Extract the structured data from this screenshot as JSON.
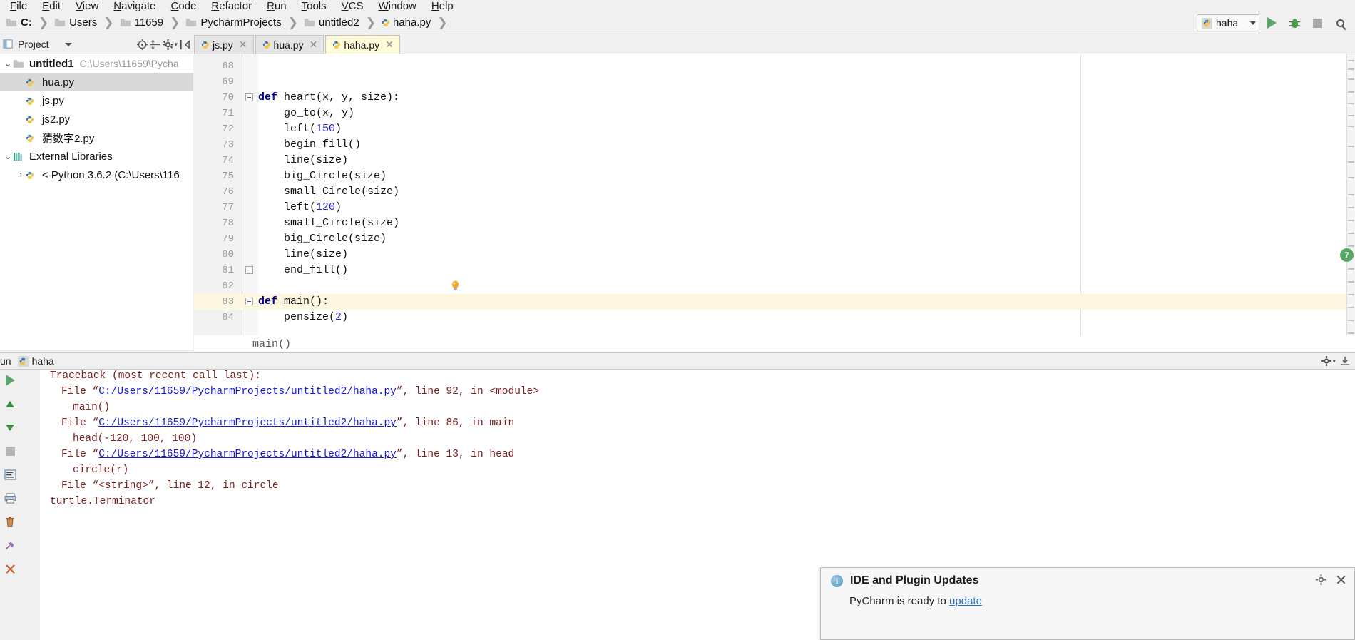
{
  "menu": {
    "items": [
      "File",
      "Edit",
      "View",
      "Navigate",
      "Code",
      "Refactor",
      "Run",
      "Tools",
      "VCS",
      "Window",
      "Help"
    ]
  },
  "navbar": {
    "crumbs": [
      {
        "label": "C:",
        "icon": "folder-icon",
        "bold": true
      },
      {
        "label": "Users",
        "icon": "folder-icon",
        "bold": false
      },
      {
        "label": "11659",
        "icon": "folder-icon",
        "bold": false
      },
      {
        "label": "PycharmProjects",
        "icon": "folder-icon",
        "bold": false
      },
      {
        "label": "untitled2",
        "icon": "folder-icon",
        "bold": false
      },
      {
        "label": "haha.py",
        "icon": "python-file-icon",
        "bold": false
      }
    ],
    "separator": "❯"
  },
  "toolbar": {
    "run_config": "haha",
    "run_button": "run-icon",
    "debug_button": "debug-icon",
    "stop_button": "stop-icon",
    "search_button": "search-icon"
  },
  "project_panel": {
    "title": "Project",
    "tree": [
      {
        "label": "untitled1",
        "path": "C:\\Users\\11659\\Pycha",
        "icon": "folder-icon",
        "bold": true,
        "arrow": "⌄",
        "indent": 0,
        "selected": false
      },
      {
        "label": "hua.py",
        "path": "",
        "icon": "python-file-icon",
        "bold": false,
        "arrow": "",
        "indent": 1,
        "selected": true
      },
      {
        "label": "js.py",
        "path": "",
        "icon": "python-file-icon",
        "bold": false,
        "arrow": "",
        "indent": 1,
        "selected": false
      },
      {
        "label": "js2.py",
        "path": "",
        "icon": "python-file-icon",
        "bold": false,
        "arrow": "",
        "indent": 1,
        "selected": false
      },
      {
        "label": "猜数字2.py",
        "path": "",
        "icon": "python-file-icon",
        "bold": false,
        "arrow": "",
        "indent": 1,
        "selected": false
      },
      {
        "label": "External Libraries",
        "path": "",
        "icon": "library-icon",
        "bold": false,
        "arrow": "⌄",
        "indent": 0,
        "selected": false
      },
      {
        "label": "< Python 3.6.2 (C:\\Users\\116",
        "path": "",
        "icon": "python-interpreter-icon",
        "bold": false,
        "arrow": "›",
        "indent": 1,
        "selected": false
      }
    ]
  },
  "editor": {
    "tabs": [
      {
        "label": "js.py",
        "active": false
      },
      {
        "label": "hua.py",
        "active": false
      },
      {
        "label": "haha.py",
        "active": true
      }
    ],
    "close_glyph": "✕",
    "breadcrumb": "main()",
    "first_line_number": 68,
    "lines": [
      {
        "n": 68,
        "text": "",
        "fold": false,
        "current": false
      },
      {
        "n": 69,
        "text": "",
        "fold": false,
        "current": false
      },
      {
        "n": 70,
        "text": "def heart(x, y, size):",
        "fold": true,
        "current": false
      },
      {
        "n": 71,
        "text": "    go_to(x, y)",
        "fold": false,
        "current": false
      },
      {
        "n": 72,
        "text": "    left(150)",
        "fold": false,
        "current": false
      },
      {
        "n": 73,
        "text": "    begin_fill()",
        "fold": false,
        "current": false
      },
      {
        "n": 74,
        "text": "    line(size)",
        "fold": false,
        "current": false
      },
      {
        "n": 75,
        "text": "    big_Circle(size)",
        "fold": false,
        "current": false
      },
      {
        "n": 76,
        "text": "    small_Circle(size)",
        "fold": false,
        "current": false
      },
      {
        "n": 77,
        "text": "    left(120)",
        "fold": false,
        "current": false
      },
      {
        "n": 78,
        "text": "    small_Circle(size)",
        "fold": false,
        "current": false
      },
      {
        "n": 79,
        "text": "    big_Circle(size)",
        "fold": false,
        "current": false
      },
      {
        "n": 80,
        "text": "    line(size)",
        "fold": false,
        "current": false
      },
      {
        "n": 81,
        "text": "    end_fill()",
        "fold": true,
        "current": false
      },
      {
        "n": 82,
        "text": "",
        "fold": false,
        "current": false
      },
      {
        "n": 83,
        "text": "def main():",
        "fold": true,
        "current": true
      },
      {
        "n": 84,
        "text": "    pensize(2)",
        "fold": false,
        "current": false
      }
    ],
    "inspection_badge": "7"
  },
  "run_window": {
    "title": "un",
    "config_name": "haha",
    "console_lines": [
      {
        "pre": "Traceback (most recent call last):",
        "link": "",
        "post": "",
        "indent": 0
      },
      {
        "pre": "File “",
        "link": "C:/Users/11659/PycharmProjects/untitled2/haha.py",
        "post": "”, line 92, in <module>",
        "indent": 1
      },
      {
        "pre": "main()",
        "link": "",
        "post": "",
        "indent": 2
      },
      {
        "pre": "File “",
        "link": "C:/Users/11659/PycharmProjects/untitled2/haha.py",
        "post": "”, line 86, in main",
        "indent": 1
      },
      {
        "pre": "head(-120, 100, 100)",
        "link": "",
        "post": "",
        "indent": 2
      },
      {
        "pre": "File “",
        "link": "C:/Users/11659/PycharmProjects/untitled2/haha.py",
        "post": "”, line 13, in head",
        "indent": 1
      },
      {
        "pre": "circle(r)",
        "link": "",
        "post": "",
        "indent": 2
      },
      {
        "pre": "File “<string>”, line 12, in circle",
        "link": "",
        "post": "",
        "indent": 1
      },
      {
        "pre": "turtle.Terminator",
        "link": "",
        "post": "",
        "indent": 0
      }
    ],
    "side_buttons": [
      "rerun-icon",
      "up-arrow-icon",
      "down-arrow-icon",
      "soft-wrap-icon",
      "print-icon",
      "scroll-to-end-icon",
      "trash-icon",
      "pin-icon",
      "close-icon"
    ]
  },
  "notification": {
    "icon": "info-icon",
    "title": "IDE and Plugin Updates",
    "body_before": "PyCharm is ready to ",
    "body_link": "update",
    "settings_icon": "gear-icon",
    "close_icon": "close-icon"
  }
}
